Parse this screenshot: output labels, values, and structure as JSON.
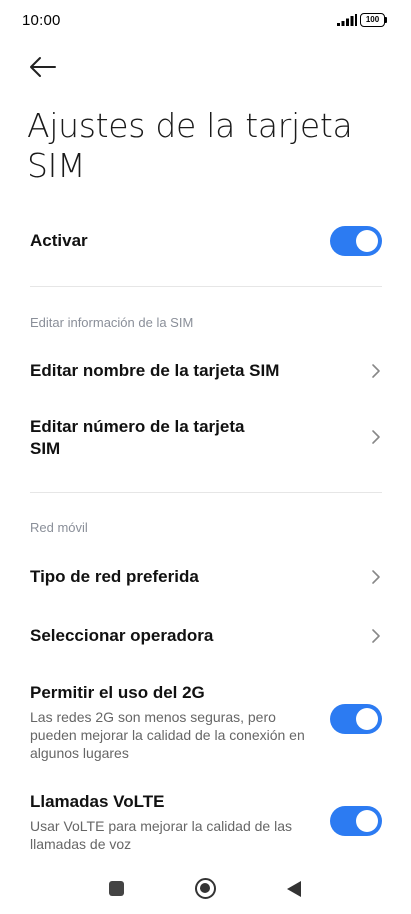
{
  "status_bar": {
    "time": "10:00",
    "battery": "100",
    "icons": [
      "signal-icon",
      "battery-icon"
    ]
  },
  "header": {
    "back_icon": "back-arrow-icon",
    "title": "Ajustes de la tarjeta SIM"
  },
  "activate": {
    "label": "Activar",
    "enabled": true
  },
  "sim_section": {
    "header": "Editar información de la SIM",
    "items": [
      {
        "label": "Editar nombre de la tarjeta SIM"
      },
      {
        "label": "Editar número de la tarjeta SIM"
      }
    ]
  },
  "network_section": {
    "header": "Red móvil",
    "items": [
      {
        "label": "Tipo de red preferida"
      },
      {
        "label": "Seleccionar operadora"
      }
    ],
    "allow_2g": {
      "label": "Permitir el uso del 2G",
      "description": "Las redes 2G son menos seguras, pero pueden mejorar la calidad de la conexión en algunos lugares",
      "enabled": true
    },
    "volte": {
      "label": "Llamadas VoLTE",
      "description": "Usar VoLTE para mejorar la calidad de las llamadas de voz",
      "enabled": true
    }
  },
  "colors": {
    "accent": "#2c7bf2",
    "section_header": "#8a8f99"
  },
  "nav_bar": {
    "icons": [
      "recents-square-icon",
      "home-circle-icon",
      "back-triangle-icon"
    ]
  }
}
